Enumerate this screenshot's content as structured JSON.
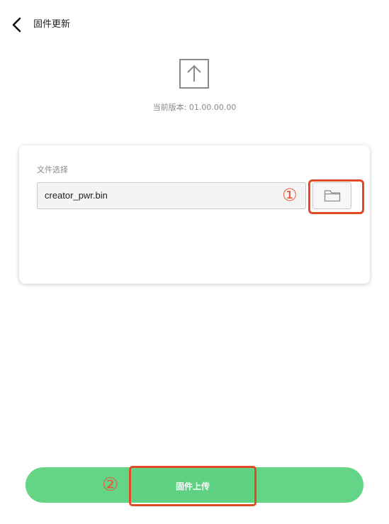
{
  "header": {
    "title": "固件更新",
    "back_icon": "chevron-left-icon"
  },
  "version": {
    "label": "当前版本:",
    "value": "01.00.00.00"
  },
  "file_select": {
    "label": "文件选择",
    "value": "creator_pwr.bin",
    "browse_icon": "folder-icon"
  },
  "annotations": {
    "marker_1": "①",
    "marker_2": "②",
    "highlight_color": "#e04a22"
  },
  "actions": {
    "upload_label": "固件上传"
  },
  "colors": {
    "accent_green": "#64d586",
    "annotation_red": "#e04a22"
  }
}
